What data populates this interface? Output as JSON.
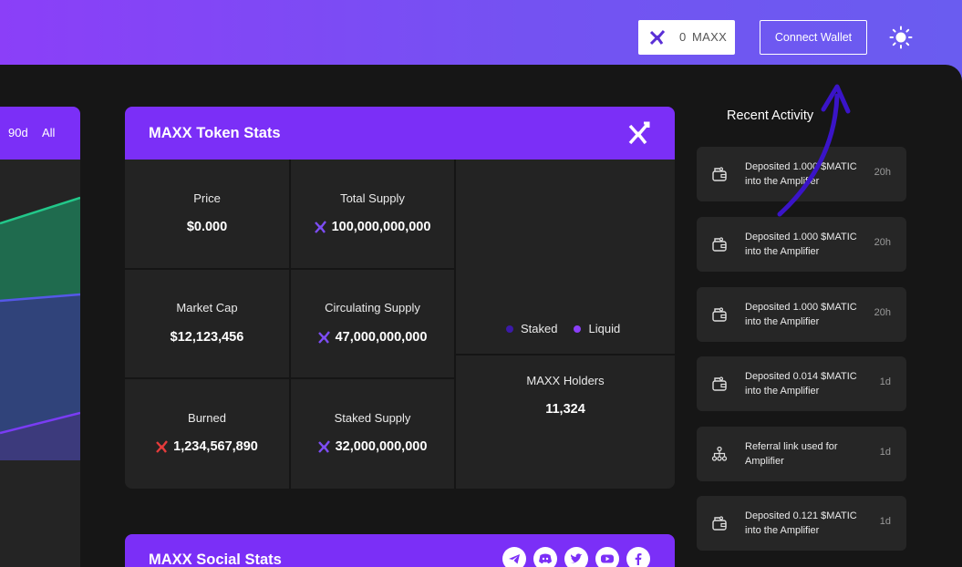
{
  "header": {
    "balance_value": "0",
    "balance_symbol": "MAXX",
    "connect_label": "Connect Wallet"
  },
  "chart": {
    "range_options": [
      "90d",
      "All"
    ]
  },
  "token_stats": {
    "title": "MAXX Token Stats",
    "price_label": "Price",
    "price_value": "$0.000",
    "total_supply_label": "Total Supply",
    "total_supply_value": "100,000,000,000",
    "market_cap_label": "Market Cap",
    "market_cap_value": "$12,123,456",
    "circulating_label": "Circulating Supply",
    "circulating_value": "47,000,000,000",
    "burned_label": "Burned",
    "burned_value": "1,234,567,890",
    "staked_label": "Staked Supply",
    "staked_value": "32,000,000,000",
    "legend_staked": "Staked",
    "legend_liquid": "Liquid",
    "holders_label": "MAXX Holders",
    "holders_value": "11,324"
  },
  "activity": {
    "title": "Recent Activity",
    "items": [
      {
        "text": "Deposited 1.000 $MATIC into the Amplifier",
        "time": "20h",
        "icon": "wallet-icon"
      },
      {
        "text": "Deposited 1.000 $MATIC into the Amplifier",
        "time": "20h",
        "icon": "wallet-icon"
      },
      {
        "text": "Deposited 1.000 $MATIC into the Amplifier",
        "time": "20h",
        "icon": "wallet-icon"
      },
      {
        "text": "Deposited 0.014 $MATIC into the Amplifier",
        "time": "1d",
        "icon": "wallet-icon"
      },
      {
        "text": "Referral link used for Amplifier",
        "time": "1d",
        "icon": "network-icon"
      },
      {
        "text": "Deposited 0.121 $MATIC into the Amplifier",
        "time": "1d",
        "icon": "wallet-icon"
      }
    ]
  },
  "social": {
    "title": "MAXX Social Stats",
    "icons": [
      "telegram-icon",
      "discord-icon",
      "twitter-icon",
      "youtube-icon",
      "facebook-icon"
    ]
  },
  "colors": {
    "accent": "#7b2ff7",
    "staked": "#3b1aa8",
    "liquid": "#8a3ff8",
    "burn": "#e53b3b"
  }
}
